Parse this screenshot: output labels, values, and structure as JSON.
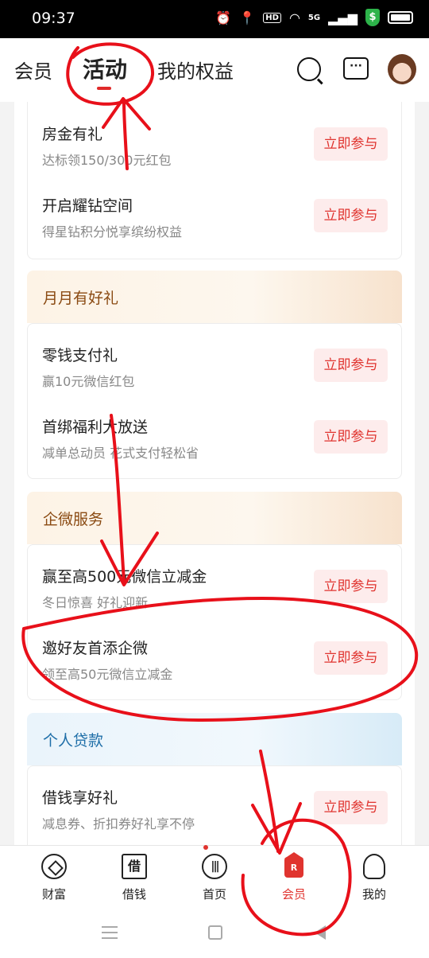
{
  "status_bar": {
    "time": "09:37",
    "hd": "HD",
    "network": "5G",
    "shield": "$"
  },
  "header": {
    "tabs": [
      {
        "label": "会员"
      },
      {
        "label": "活动"
      },
      {
        "label": "我的权益"
      }
    ],
    "message_icon_glyph": "···"
  },
  "top_card": {
    "rows": [
      {
        "title": "房金有礼",
        "subtitle": "达标领150/300元红包",
        "button": "立即参与"
      },
      {
        "title": "开启耀钻空间",
        "subtitle": "得星钻积分悦享缤纷权益",
        "button": "立即参与"
      }
    ]
  },
  "sections": [
    {
      "title": "月月有好礼",
      "rows": [
        {
          "title": "零钱支付礼",
          "subtitle": "赢10元微信红包",
          "button": "立即参与"
        },
        {
          "title": "首绑福利大放送",
          "subtitle": "减单总动员 花式支付轻松省",
          "button": "立即参与"
        }
      ]
    },
    {
      "title": "企微服务",
      "rows": [
        {
          "title": "赢至高500元微信立减金",
          "subtitle": "冬日惊喜 好礼迎新",
          "button": "立即参与"
        },
        {
          "title": "邀好友首添企微",
          "subtitle": "领至高50元微信立减金",
          "button": "立即参与"
        }
      ]
    },
    {
      "title": "个人贷款",
      "rows": [
        {
          "title": "借钱享好礼",
          "subtitle": "减息券、折扣券好礼享不停",
          "button": "立即参与"
        }
      ]
    }
  ],
  "tab_bar": {
    "items": [
      {
        "label": "财富",
        "icon": "wealth-icon"
      },
      {
        "label": "借钱",
        "icon": "borrow-icon",
        "glyph": "借"
      },
      {
        "label": "首页",
        "icon": "home-icon",
        "glyph": "|||"
      },
      {
        "label": "会员",
        "icon": "member-crown-icon",
        "glyph": "R",
        "active": true
      },
      {
        "label": "我的",
        "icon": "person-icon"
      }
    ]
  },
  "colors": {
    "accent_red": "#e0342f",
    "annotation_red": "#e8101a",
    "button_bg": "#fdecec"
  }
}
